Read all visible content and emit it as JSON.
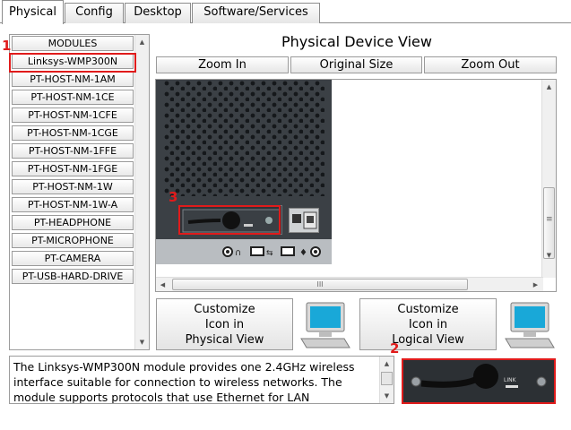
{
  "tabs": [
    {
      "label": "Physical",
      "active": true
    },
    {
      "label": "Config"
    },
    {
      "label": "Desktop"
    },
    {
      "label": "Software/Services"
    }
  ],
  "modules": {
    "header": "MODULES",
    "items": [
      "Linksys-WMP300N",
      "PT-HOST-NM-1AM",
      "PT-HOST-NM-1CE",
      "PT-HOST-NM-1CFE",
      "PT-HOST-NM-1CGE",
      "PT-HOST-NM-1FFE",
      "PT-HOST-NM-1FGE",
      "PT-HOST-NM-1W",
      "PT-HOST-NM-1W-A",
      "PT-HEADPHONE",
      "PT-MICROPHONE",
      "PT-CAMERA",
      "PT-USB-HARD-DRIVE"
    ],
    "selected": "Linksys-WMP300N"
  },
  "view": {
    "title": "Physical Device View",
    "zoom_in": "Zoom In",
    "original_size": "Original Size",
    "zoom_out": "Zoom Out",
    "hscroll_grip": "III",
    "vscroll_grip": "≡"
  },
  "customize": {
    "physical_line1": "Customize",
    "physical_line2": "Icon in",
    "physical_line3": "Physical View",
    "logical_line1": "Customize",
    "logical_line2": "Icon in",
    "logical_line3": "Logical View"
  },
  "description": "The Linksys-WMP300N module provides one 2.4GHz wireless interface suitable for connection to wireless networks. The module supports protocols that use Ethernet for LAN",
  "preview": {
    "link_label": "LINK"
  },
  "annotations": {
    "marker1": "1",
    "marker2": "2",
    "marker3": "3"
  },
  "colors": {
    "highlight": "#e01b1b",
    "device": "#3b4045",
    "pc_screen": "#19a8d8"
  }
}
